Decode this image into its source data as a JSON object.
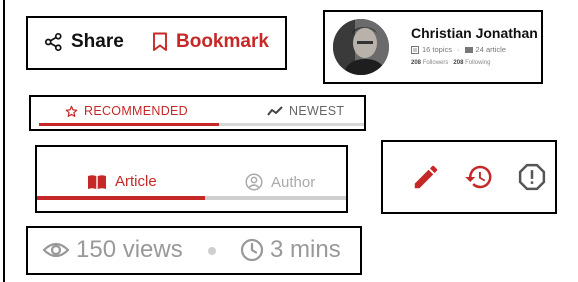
{
  "share_actions": {
    "share_label": "Share",
    "bookmark_label": "Bookmark",
    "share_icon": "share-icon",
    "bookmark_icon": "bookmark-icon"
  },
  "profile": {
    "name": "Christian Jonathan",
    "topics": "16 topics",
    "articles": "24 article",
    "followers_count": "208",
    "followers_label": "Followers",
    "following_count": "208",
    "following_label": "Following"
  },
  "feed_tabs": {
    "recommended_label": "RECOMMENDED",
    "newest_label": "NEWEST",
    "active": "recommended"
  },
  "content_tabs": {
    "article_label": "Article",
    "author_label": "Author",
    "active": "article"
  },
  "action_icons": [
    "edit-icon",
    "history-icon",
    "report-icon"
  ],
  "stats": {
    "views": "150 views",
    "read_time": "3 mins"
  },
  "colors": {
    "accent": "#c62828",
    "muted": "#9e9e9e",
    "dark": "#222222"
  }
}
